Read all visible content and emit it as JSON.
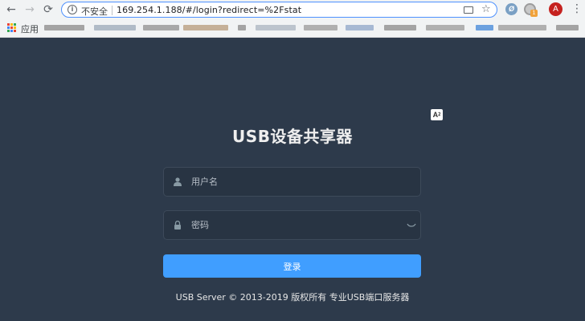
{
  "browser": {
    "back_icon": "←",
    "forward_icon": "→",
    "reload_icon": "⟳",
    "info_icon": "i",
    "security_label": "不安全",
    "url": "169.254.1.188/#/login?redirect=%2Fstat",
    "star_icon": "☆",
    "extension_label": "Ø",
    "extension_badge": "1",
    "profile_initial": "A",
    "menu_icon": "⋮",
    "apps_label": "应用",
    "accent_color": "#4d90fe"
  },
  "page": {
    "translate_label": "A⁲",
    "title": "USB设备共享器",
    "username": {
      "placeholder": "用户名",
      "value": ""
    },
    "password": {
      "placeholder": "密码",
      "value": ""
    },
    "login_label": "登录",
    "footer": "USB Server © 2013-2019 版权所有 专业USB端口服务器",
    "colors": {
      "background": "#2d3a4b",
      "input_background": "#283443",
      "button": "#409eff"
    }
  }
}
